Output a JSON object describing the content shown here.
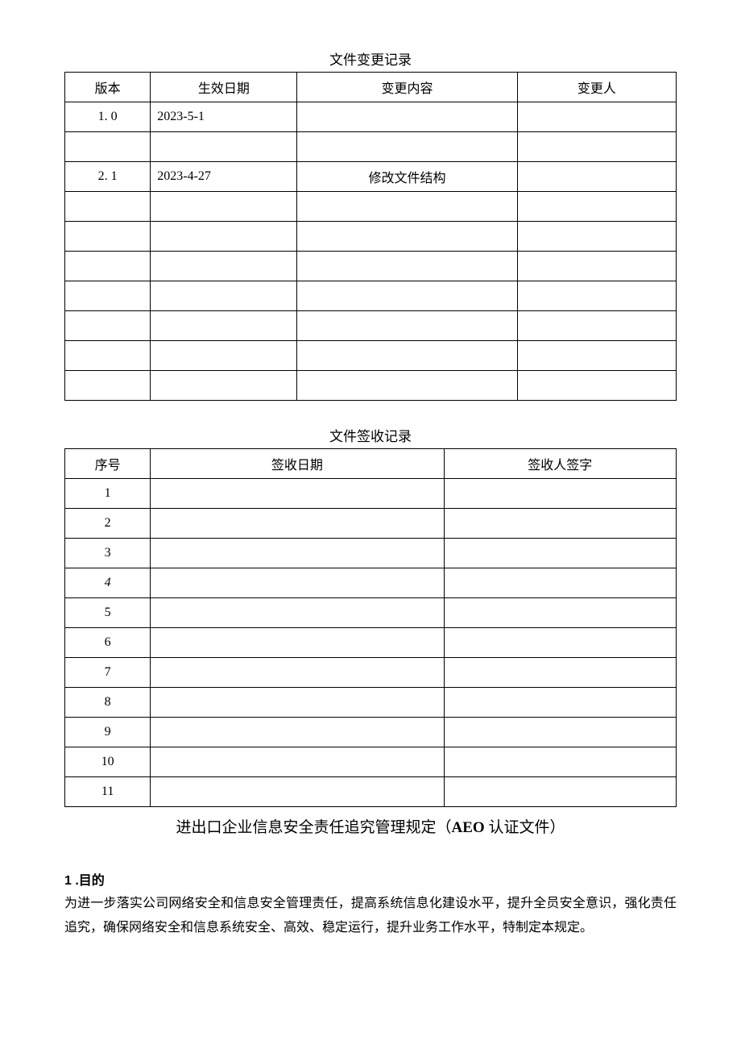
{
  "changeLog": {
    "title": "文件变更记录",
    "headers": [
      "版本",
      "生效日期",
      "变更内容",
      "变更人"
    ],
    "rows": [
      [
        "1. 0",
        "2023-5-1",
        "",
        ""
      ],
      [
        "",
        "",
        "",
        ""
      ],
      [
        "2. 1",
        "2023-4-27",
        "修改文件结构",
        ""
      ],
      [
        "",
        "",
        "",
        ""
      ],
      [
        "",
        "",
        "",
        ""
      ],
      [
        "",
        "",
        "",
        ""
      ],
      [
        "",
        "",
        "",
        ""
      ],
      [
        "",
        "",
        "",
        ""
      ],
      [
        "",
        "",
        "",
        ""
      ],
      [
        "",
        "",
        "",
        ""
      ]
    ]
  },
  "receipt": {
    "title": "文件签收记录",
    "headers": [
      "序号",
      "签收日期",
      "签收人签字"
    ],
    "rows": [
      {
        "no": "1",
        "date": "",
        "sign": "",
        "italic": false
      },
      {
        "no": "2",
        "date": "",
        "sign": "",
        "italic": false
      },
      {
        "no": "3",
        "date": "",
        "sign": "",
        "italic": false
      },
      {
        "no": "4",
        "date": "",
        "sign": "",
        "italic": true
      },
      {
        "no": "5",
        "date": "",
        "sign": "",
        "italic": false
      },
      {
        "no": "6",
        "date": "",
        "sign": "",
        "italic": false
      },
      {
        "no": "7",
        "date": "",
        "sign": "",
        "italic": false
      },
      {
        "no": "8",
        "date": "",
        "sign": "",
        "italic": false
      },
      {
        "no": "9",
        "date": "",
        "sign": "",
        "italic": false
      },
      {
        "no": "10",
        "date": "",
        "sign": "",
        "italic": false
      },
      {
        "no": "11",
        "date": "",
        "sign": "",
        "italic": false
      }
    ]
  },
  "docTitle": {
    "prefix": "进出口企业信息安全责任追究管理规定（",
    "aeo": "AEO",
    "suffix": " 认证文件）"
  },
  "section1": {
    "num": "1 .",
    "label": "目的",
    "body": "为进一步落实公司网络安全和信息安全管理责任，提高系统信息化建设水平，提升全员安全意识，强化责任追究，确保网络安全和信息系统安全、高效、稳定运行，提升业务工作水平，特制定本规定。"
  }
}
